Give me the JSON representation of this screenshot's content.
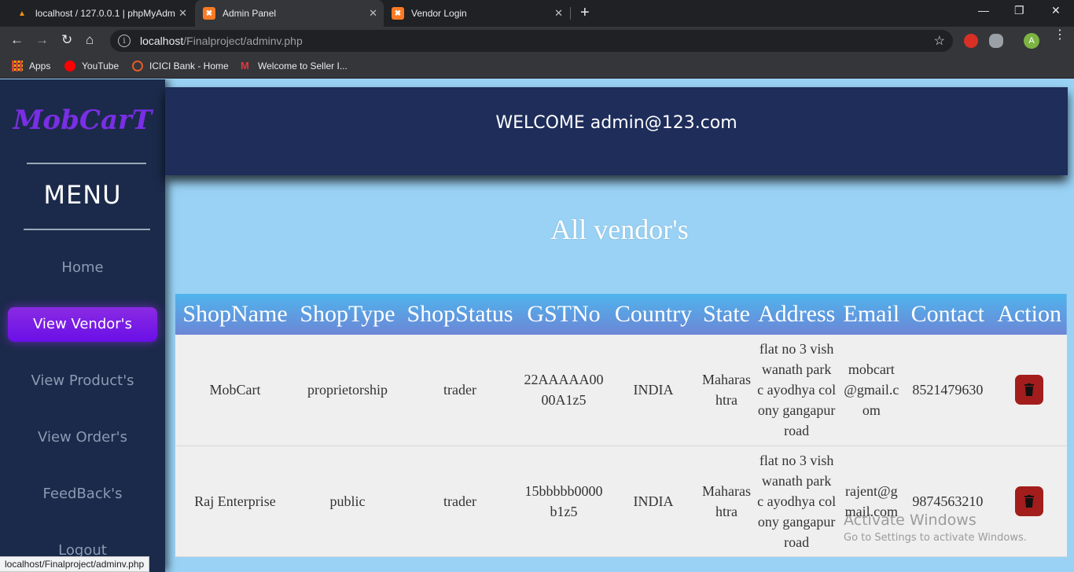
{
  "browser": {
    "tabs": [
      {
        "title": "localhost / 127.0.0.1 | phpMyAdm",
        "active": false
      },
      {
        "title": "Admin Panel",
        "active": true
      },
      {
        "title": "Vendor Login",
        "active": false
      }
    ],
    "url_host": "localhost",
    "url_path": "/Finalproject/adminv.php",
    "profile_initial": "A",
    "bookmarks": [
      "Apps",
      "YouTube",
      "ICICI Bank - Home",
      "Welcome to Seller I..."
    ],
    "status_url": "localhost/Finalproject/adminv.php"
  },
  "sidebar": {
    "logo": "MobCarT",
    "menu_title": "MENU",
    "items": [
      "Home",
      "View Vendor's",
      "View Product's",
      "View Order's",
      "FeedBack's",
      "Logout"
    ],
    "active_index": 1
  },
  "header": {
    "welcome": "WELCOME admin@123.com"
  },
  "main": {
    "heading": "All vendor's",
    "columns": [
      "ShopName",
      "ShopType",
      "ShopStatus",
      "GSTNo",
      "Country",
      "State",
      "Address",
      "Email",
      "Contact",
      "Action"
    ],
    "rows": [
      {
        "shopname": "MobCart",
        "shoptype": "proprietorship",
        "status": "trader",
        "gst": "22AAAAA0000A1z5",
        "country": "INDIA",
        "state": "Maharashtra",
        "address": "flat no 3 vishwanath park c ayodhya colony gangapur road",
        "email": "mobcart@gmail.com",
        "contact": "8521479630"
      },
      {
        "shopname": "Raj Enterprise",
        "shoptype": "public",
        "status": "trader",
        "gst": "15bbbbb0000b1z5",
        "country": "INDIA",
        "state": "Maharashtra",
        "address": "flat no 3 vishwanath park c ayodhya colony gangapur road",
        "email": "rajent@gmail.com",
        "contact": "9874563210"
      }
    ]
  },
  "watermark": {
    "line1": "Activate Windows",
    "line2": "Go to Settings to activate Windows."
  },
  "colors": {
    "accent": "#7a2ee6",
    "sidebar": "#1b2a4a",
    "delete": "#a31d1d",
    "header": "#1e2d5a",
    "background": "#9ad2f5"
  }
}
